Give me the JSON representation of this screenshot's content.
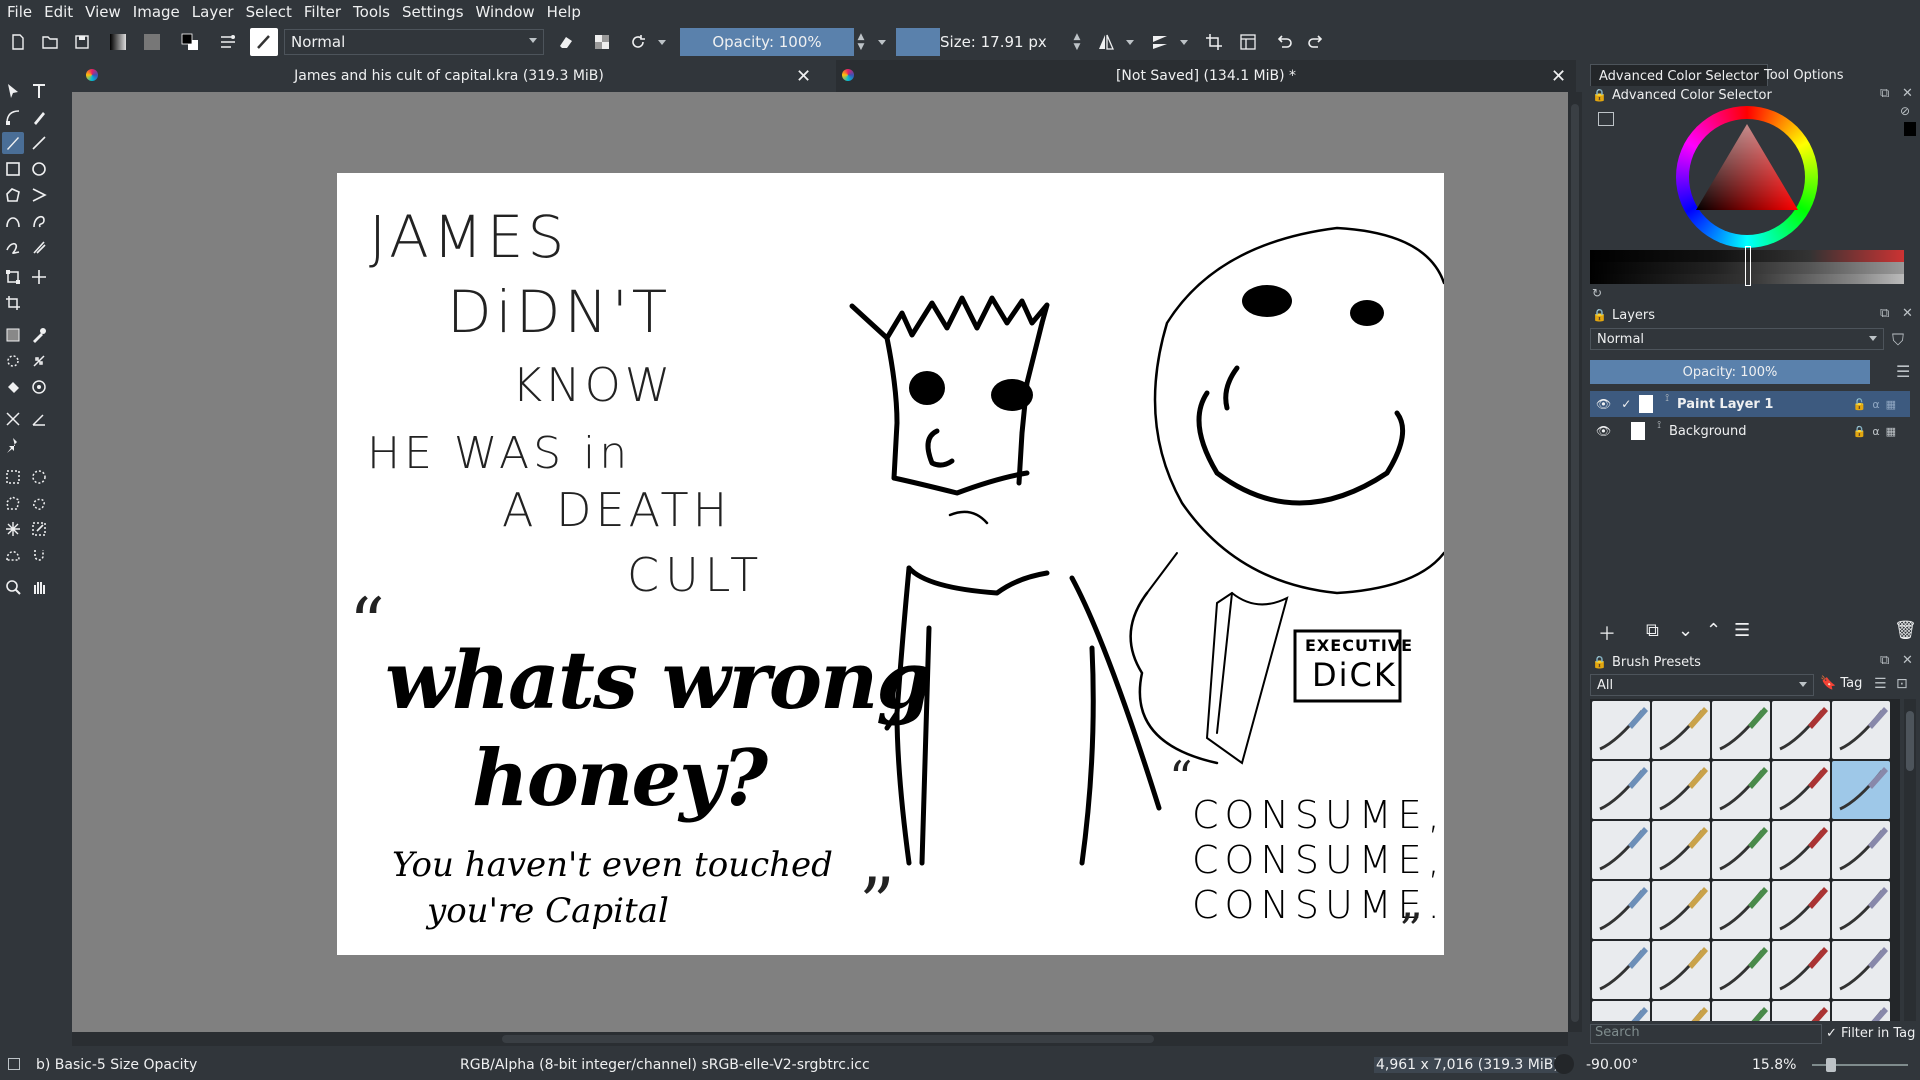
{
  "menu": [
    "File",
    "Edit",
    "View",
    "Image",
    "Layer",
    "Select",
    "Filter",
    "Tools",
    "Settings",
    "Window",
    "Help"
  ],
  "toolbar": {
    "blend_mode": "Normal",
    "opacity": "Opacity: 100%",
    "size": "Size: 17.91 px"
  },
  "tabs": [
    {
      "title": "James and his cult of capital.kra (319.3 MiB)"
    },
    {
      "title": "[Not Saved]  (134.1 MiB) *"
    }
  ],
  "drawing": {
    "text1": "JAMES",
    "text2": "DiDN'T",
    "text3": "KNOW",
    "text4": "HE WAS in",
    "text5": "A DEATH",
    "text6": "CULT",
    "quote_open": "“",
    "wife_line1": "whats wrong",
    "wife_line2": "honey?",
    "wife_line3": "You haven't even touched",
    "wife_line4": "you're Capital",
    "quote_close": "”",
    "boss_quote_open": "“",
    "boss_line1": "CONSUME,",
    "boss_line2": "CONSUME,",
    "boss_line3": "CONSUME.",
    "boss_quote_close": "”",
    "badge_line1": "EXECUTIVE",
    "badge_line2": "DiCK"
  },
  "dock": {
    "tab_color": "Advanced Color Selector",
    "tab_tool": "Tool Options",
    "color_panel_title": "Advanced Color Selector",
    "layers_title": "Layers",
    "layers_blend": "Normal",
    "layers_opacity": "Opacity:  100%",
    "layers": [
      {
        "name": "Paint Layer 1"
      },
      {
        "name": "Background"
      }
    ],
    "brush_title": "Brush Presets",
    "brush_filter": "All",
    "brush_tag": "Tag",
    "search_placeholder": "Search",
    "filter_in_tag": "Filter in Tag"
  },
  "status": {
    "brush": "b) Basic-5 Size Opacity",
    "color_model": "RGB/Alpha (8-bit integer/channel)  sRGB-elle-V2-srgbtrc.icc",
    "dimensions": "4,961 x 7,016 (319.3 MiB)",
    "rotation": "-90.00°",
    "zoom": "15.8%"
  }
}
